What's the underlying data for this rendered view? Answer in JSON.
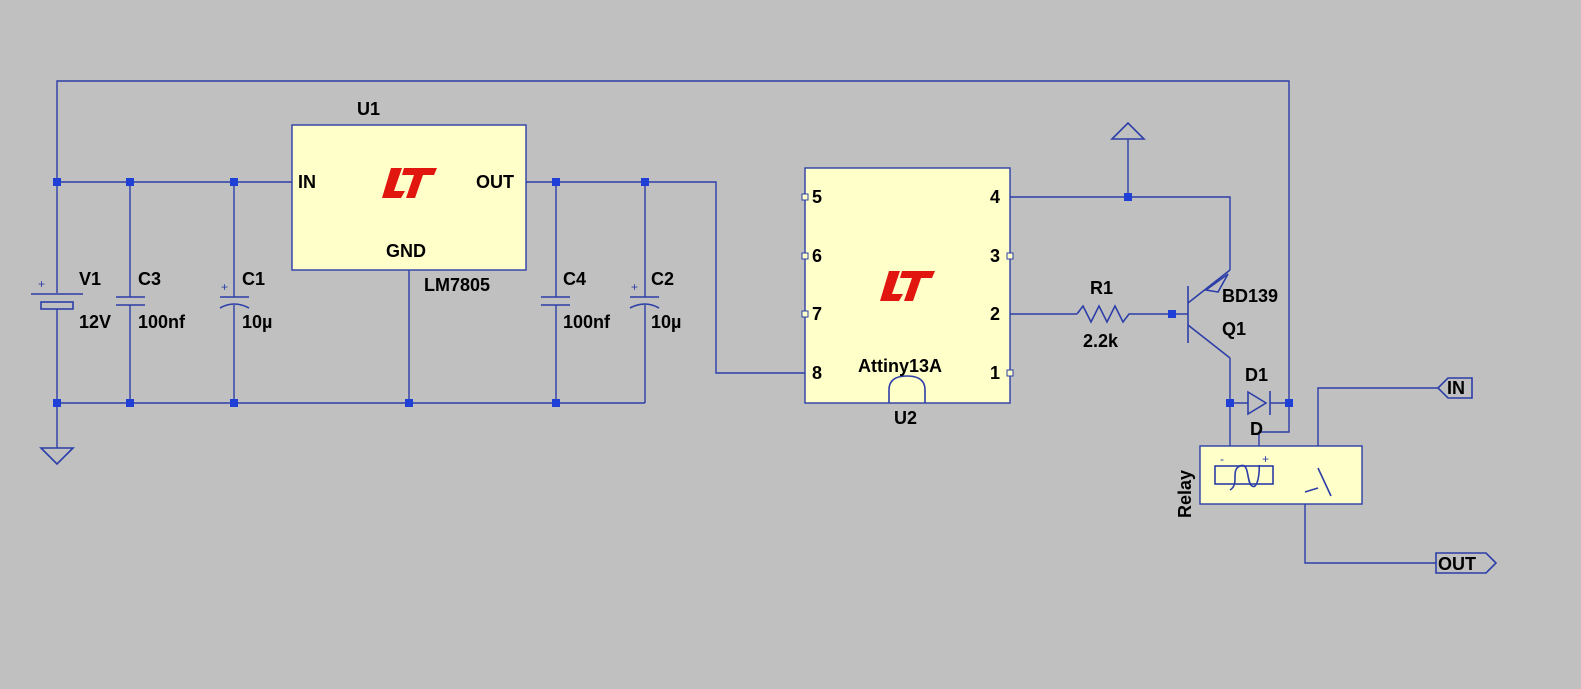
{
  "components": {
    "v1": {
      "name": "V1",
      "value": "12V"
    },
    "c3": {
      "name": "C3",
      "value": "100nf"
    },
    "c1": {
      "name": "C1",
      "value": "10µ"
    },
    "c4": {
      "name": "C4",
      "value": "100nf"
    },
    "c2": {
      "name": "C2",
      "value": "10µ"
    },
    "u1": {
      "name": "U1",
      "part": "LM7805",
      "pin_in": "IN",
      "pin_out": "OUT",
      "pin_gnd": "GND"
    },
    "u2": {
      "name": "U2",
      "part": "Attiny13A",
      "pins": [
        "5",
        "6",
        "7",
        "8",
        "4",
        "3",
        "2",
        "1"
      ]
    },
    "r1": {
      "name": "R1",
      "value": "2.2k"
    },
    "q1": {
      "name": "Q1",
      "part": "BD139"
    },
    "d1": {
      "name": "D1",
      "part": "D"
    },
    "relay": {
      "name": "Relay",
      "coil_minus": "-",
      "coil_plus": "+"
    }
  },
  "net_labels": {
    "in": "IN",
    "out": "OUT"
  },
  "colors": {
    "background": "#c0c0c0",
    "wire": "#2c3ea8",
    "component_fill": "#ffffc9",
    "junction": "#1f3fd6",
    "logo": "#e0160f"
  }
}
